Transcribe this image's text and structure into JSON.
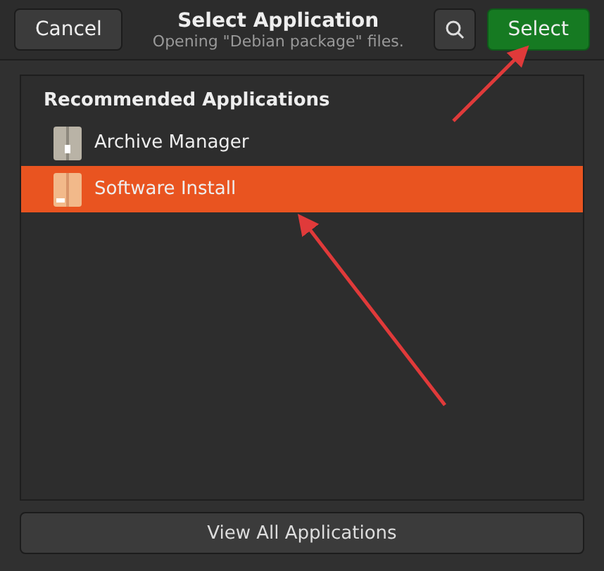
{
  "header": {
    "cancel": "Cancel",
    "title": "Select Application",
    "subtitle": "Opening \"Debian package\" files.",
    "select": "Select"
  },
  "list": {
    "heading": "Recommended Applications",
    "items": [
      {
        "name": "Archive Manager",
        "kind": "archive",
        "selected": false
      },
      {
        "name": "Software Install",
        "kind": "package",
        "selected": true
      }
    ]
  },
  "footer_button": "View All Applications"
}
